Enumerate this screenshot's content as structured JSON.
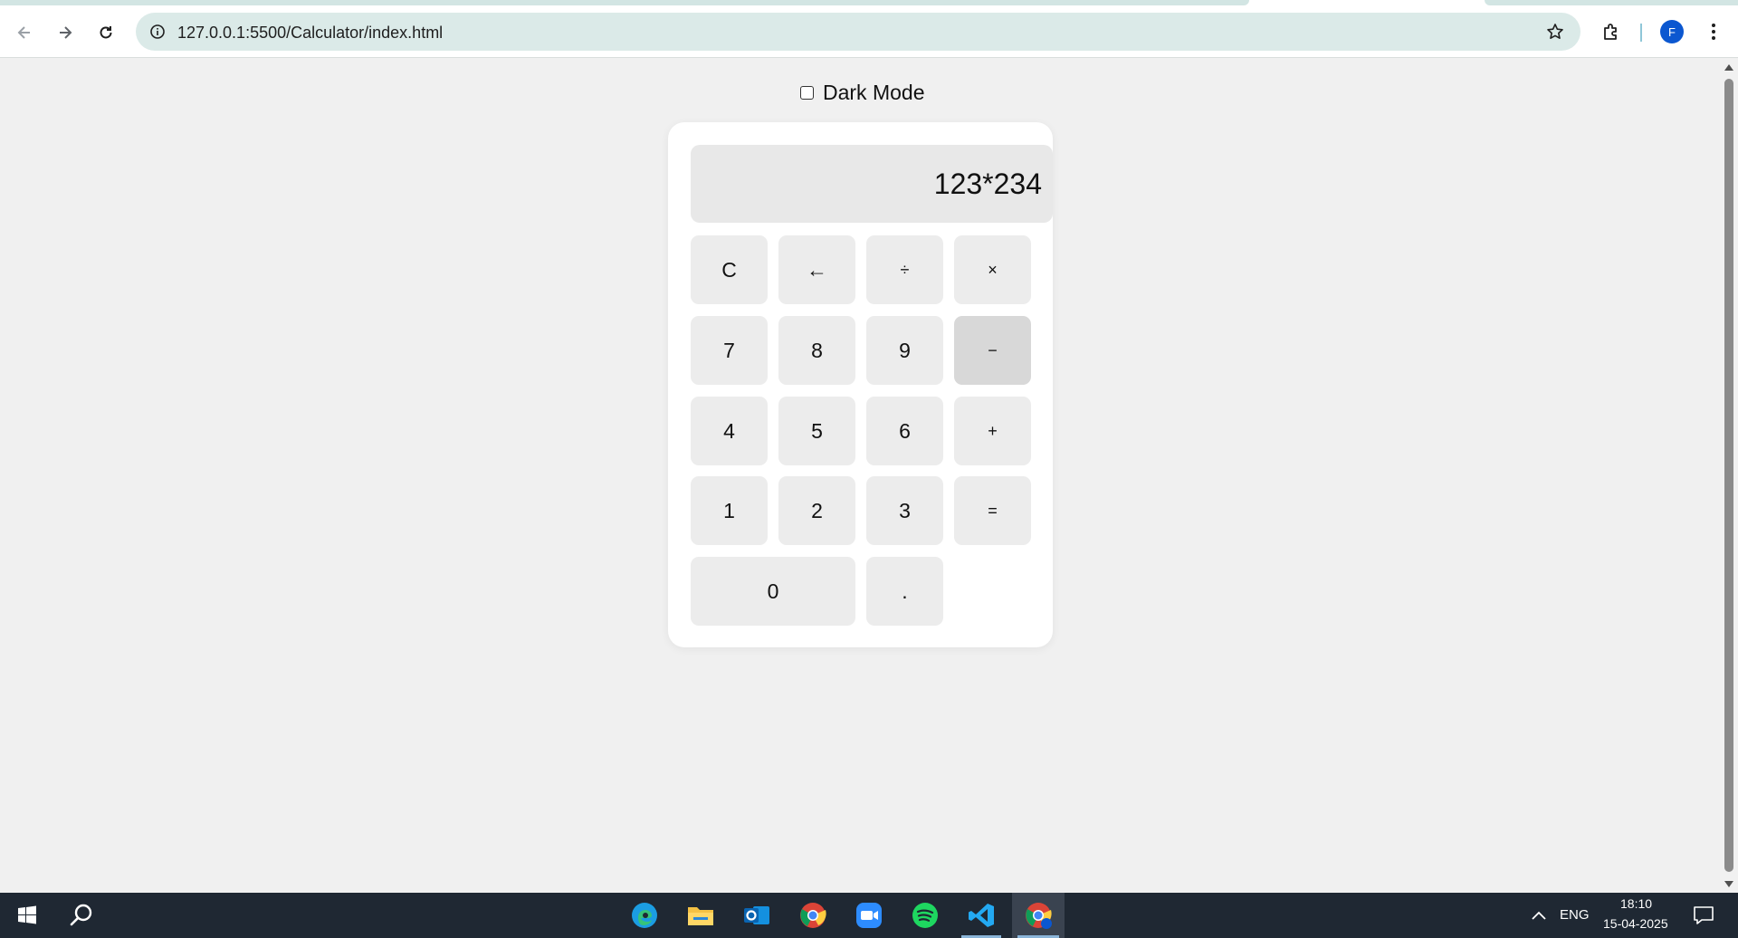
{
  "browser": {
    "url": "127.0.0.1:5500/Calculator/index.html",
    "profile_initial": "F"
  },
  "page": {
    "dark_mode_label": "Dark Mode",
    "dark_mode_checked": false,
    "display_value": "123*234",
    "keys": {
      "clear": "C",
      "backspace": "←",
      "divide": "÷",
      "multiply": "×",
      "seven": "7",
      "eight": "8",
      "nine": "9",
      "minus": "−",
      "four": "4",
      "five": "5",
      "six": "6",
      "plus": "+",
      "one": "1",
      "two": "2",
      "three": "3",
      "equals": "=",
      "zero": "0",
      "decimal": "."
    }
  },
  "taskbar": {
    "language": "ENG",
    "time": "18:10",
    "date": "15-04-2025",
    "pinned_apps": [
      "edge-icon",
      "file-explorer-icon",
      "outlook-icon",
      "chrome-icon",
      "zoom-icon",
      "spotify-icon",
      "vscode-icon",
      "chrome-profile-icon"
    ]
  }
}
